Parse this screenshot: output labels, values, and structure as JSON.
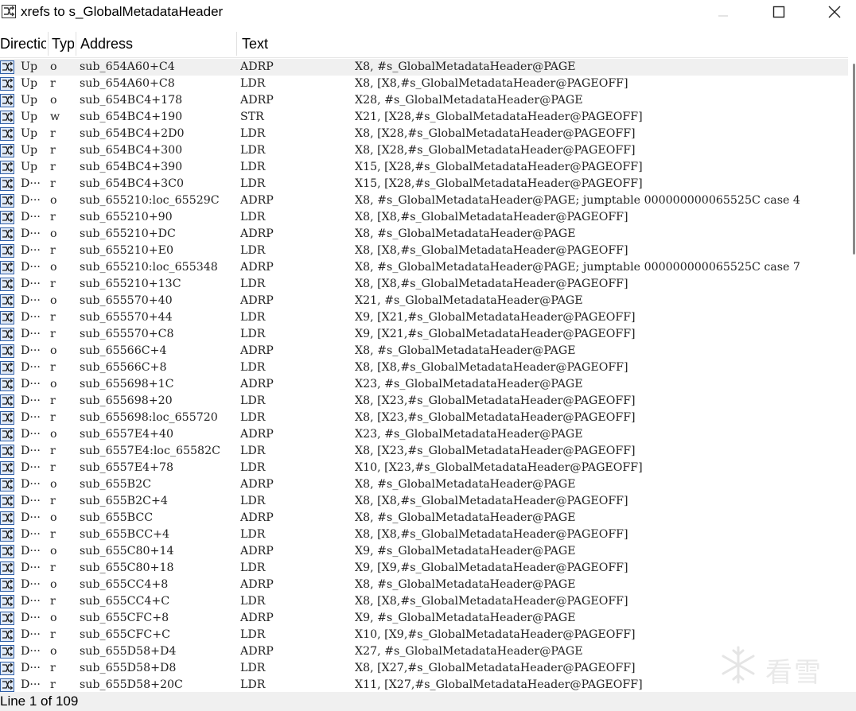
{
  "window": {
    "title": "xrefs to s_GlobalMetadataHeader",
    "icon": "xref-window-icon",
    "buttons": [
      "minimize",
      "maximize",
      "close"
    ]
  },
  "columns": {
    "direction": "Directio",
    "type": "Typ",
    "address": "Address",
    "text": "Text"
  },
  "rows": [
    {
      "dir": "Up",
      "type": "o",
      "addr": "sub_654A60+C4",
      "mn": "ADRP",
      "ops": "X8, #s_GlobalMetadataHeader@PAGE"
    },
    {
      "dir": "Up",
      "type": "r",
      "addr": "sub_654A60+C8",
      "mn": "LDR",
      "ops": "X8, [X8,#s_GlobalMetadataHeader@PAGEOFF]"
    },
    {
      "dir": "Up",
      "type": "o",
      "addr": "sub_654BC4+178",
      "mn": "ADRP",
      "ops": "X28, #s_GlobalMetadataHeader@PAGE"
    },
    {
      "dir": "Up",
      "type": "w",
      "addr": "sub_654BC4+190",
      "mn": "STR",
      "ops": "X21, [X28,#s_GlobalMetadataHeader@PAGEOFF]"
    },
    {
      "dir": "Up",
      "type": "r",
      "addr": "sub_654BC4+2D0",
      "mn": "LDR",
      "ops": "X8, [X28,#s_GlobalMetadataHeader@PAGEOFF]"
    },
    {
      "dir": "Up",
      "type": "r",
      "addr": "sub_654BC4+300",
      "mn": "LDR",
      "ops": "X8, [X28,#s_GlobalMetadataHeader@PAGEOFF]"
    },
    {
      "dir": "Up",
      "type": "r",
      "addr": "sub_654BC4+390",
      "mn": "LDR",
      "ops": "X15, [X28,#s_GlobalMetadataHeader@PAGEOFF]"
    },
    {
      "dir": "D···",
      "type": "r",
      "addr": "sub_654BC4+3C0",
      "mn": "LDR",
      "ops": "X15, [X28,#s_GlobalMetadataHeader@PAGEOFF]"
    },
    {
      "dir": "D···",
      "type": "o",
      "addr": "sub_655210:loc_65529C",
      "mn": "ADRP",
      "ops": "X8, #s_GlobalMetadataHeader@PAGE; jumptable 000000000065525C case 4"
    },
    {
      "dir": "D···",
      "type": "r",
      "addr": "sub_655210+90",
      "mn": "LDR",
      "ops": "X8, [X8,#s_GlobalMetadataHeader@PAGEOFF]"
    },
    {
      "dir": "D···",
      "type": "o",
      "addr": "sub_655210+DC",
      "mn": "ADRP",
      "ops": "X8, #s_GlobalMetadataHeader@PAGE"
    },
    {
      "dir": "D···",
      "type": "r",
      "addr": "sub_655210+E0",
      "mn": "LDR",
      "ops": "X8, [X8,#s_GlobalMetadataHeader@PAGEOFF]"
    },
    {
      "dir": "D···",
      "type": "o",
      "addr": "sub_655210:loc_655348",
      "mn": "ADRP",
      "ops": "X8, #s_GlobalMetadataHeader@PAGE; jumptable 000000000065525C case 7"
    },
    {
      "dir": "D···",
      "type": "r",
      "addr": "sub_655210+13C",
      "mn": "LDR",
      "ops": "X8, [X8,#s_GlobalMetadataHeader@PAGEOFF]"
    },
    {
      "dir": "D···",
      "type": "o",
      "addr": "sub_655570+40",
      "mn": "ADRP",
      "ops": "X21, #s_GlobalMetadataHeader@PAGE"
    },
    {
      "dir": "D···",
      "type": "r",
      "addr": "sub_655570+44",
      "mn": "LDR",
      "ops": "X9, [X21,#s_GlobalMetadataHeader@PAGEOFF]"
    },
    {
      "dir": "D···",
      "type": "r",
      "addr": "sub_655570+C8",
      "mn": "LDR",
      "ops": "X9, [X21,#s_GlobalMetadataHeader@PAGEOFF]"
    },
    {
      "dir": "D···",
      "type": "o",
      "addr": "sub_65566C+4",
      "mn": "ADRP",
      "ops": "X8, #s_GlobalMetadataHeader@PAGE"
    },
    {
      "dir": "D···",
      "type": "r",
      "addr": "sub_65566C+8",
      "mn": "LDR",
      "ops": "X8, [X8,#s_GlobalMetadataHeader@PAGEOFF]"
    },
    {
      "dir": "D···",
      "type": "o",
      "addr": "sub_655698+1C",
      "mn": "ADRP",
      "ops": "X23, #s_GlobalMetadataHeader@PAGE"
    },
    {
      "dir": "D···",
      "type": "r",
      "addr": "sub_655698+20",
      "mn": "LDR",
      "ops": "X8, [X23,#s_GlobalMetadataHeader@PAGEOFF]"
    },
    {
      "dir": "D···",
      "type": "r",
      "addr": "sub_655698:loc_655720",
      "mn": "LDR",
      "ops": "X8, [X23,#s_GlobalMetadataHeader@PAGEOFF]"
    },
    {
      "dir": "D···",
      "type": "o",
      "addr": "sub_6557E4+40",
      "mn": "ADRP",
      "ops": "X23, #s_GlobalMetadataHeader@PAGE"
    },
    {
      "dir": "D···",
      "type": "r",
      "addr": "sub_6557E4:loc_65582C",
      "mn": "LDR",
      "ops": "X8, [X23,#s_GlobalMetadataHeader@PAGEOFF]"
    },
    {
      "dir": "D···",
      "type": "r",
      "addr": "sub_6557E4+78",
      "mn": "LDR",
      "ops": "X10, [X23,#s_GlobalMetadataHeader@PAGEOFF]"
    },
    {
      "dir": "D···",
      "type": "o",
      "addr": "sub_655B2C",
      "mn": "ADRP",
      "ops": "X8, #s_GlobalMetadataHeader@PAGE"
    },
    {
      "dir": "D···",
      "type": "r",
      "addr": "sub_655B2C+4",
      "mn": "LDR",
      "ops": "X8, [X8,#s_GlobalMetadataHeader@PAGEOFF]"
    },
    {
      "dir": "D···",
      "type": "o",
      "addr": "sub_655BCC",
      "mn": "ADRP",
      "ops": "X8, #s_GlobalMetadataHeader@PAGE"
    },
    {
      "dir": "D···",
      "type": "r",
      "addr": "sub_655BCC+4",
      "mn": "LDR",
      "ops": "X8, [X8,#s_GlobalMetadataHeader@PAGEOFF]"
    },
    {
      "dir": "D···",
      "type": "o",
      "addr": "sub_655C80+14",
      "mn": "ADRP",
      "ops": "X9, #s_GlobalMetadataHeader@PAGE"
    },
    {
      "dir": "D···",
      "type": "r",
      "addr": "sub_655C80+18",
      "mn": "LDR",
      "ops": "X9, [X9,#s_GlobalMetadataHeader@PAGEOFF]"
    },
    {
      "dir": "D···",
      "type": "o",
      "addr": "sub_655CC4+8",
      "mn": "ADRP",
      "ops": "X8, #s_GlobalMetadataHeader@PAGE"
    },
    {
      "dir": "D···",
      "type": "r",
      "addr": "sub_655CC4+C",
      "mn": "LDR",
      "ops": "X8, [X8,#s_GlobalMetadataHeader@PAGEOFF]"
    },
    {
      "dir": "D···",
      "type": "o",
      "addr": "sub_655CFC+8",
      "mn": "ADRP",
      "ops": "X9, #s_GlobalMetadataHeader@PAGE"
    },
    {
      "dir": "D···",
      "type": "r",
      "addr": "sub_655CFC+C",
      "mn": "LDR",
      "ops": "X10, [X9,#s_GlobalMetadataHeader@PAGEOFF]"
    },
    {
      "dir": "D···",
      "type": "o",
      "addr": "sub_655D58+D4",
      "mn": "ADRP",
      "ops": "X27, #s_GlobalMetadataHeader@PAGE"
    },
    {
      "dir": "D···",
      "type": "r",
      "addr": "sub_655D58+D8",
      "mn": "LDR",
      "ops": "X8, [X27,#s_GlobalMetadataHeader@PAGEOFF]"
    },
    {
      "dir": "D···",
      "type": "r",
      "addr": "sub_655D58+20C",
      "mn": "LDR",
      "ops": "X11, [X27,#s_GlobalMetadataHeader@PAGEOFF]"
    }
  ],
  "status": {
    "text": "Line 1 of 109"
  },
  "watermark": {
    "text": "看雪"
  },
  "colors": {
    "selected_row": "#f0f0f0",
    "status_bar": "#f0f0f0",
    "icon_blue": "#2f5fa8"
  }
}
